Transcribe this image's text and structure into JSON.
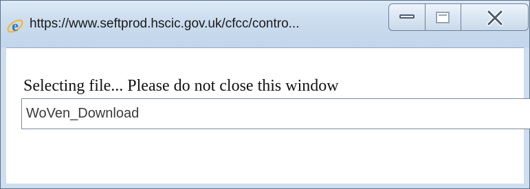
{
  "window": {
    "title": "https://www.seftprod.hscic.gov.uk/cfcc/contro...",
    "app_icon": "internet-explorer-icon",
    "caption_buttons": {
      "minimize": "minimize-icon",
      "maximize": "maximize-icon",
      "close": "close-icon"
    }
  },
  "content": {
    "message": "Selecting file... Please do not close this window",
    "file_field": {
      "value": "WoVen_Download"
    }
  },
  "colors": {
    "title_bar": "#cbdcee",
    "window_border": "#5a6f86",
    "ie_icon_blue": "#2b78c6",
    "ie_icon_ring": "#f2b632"
  }
}
